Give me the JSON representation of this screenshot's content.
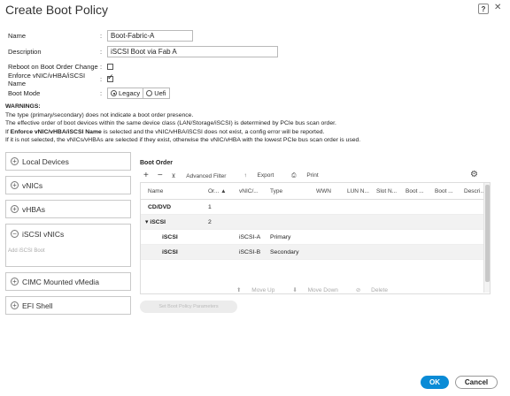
{
  "window": {
    "title": "Create Boot Policy",
    "help_label": "?",
    "close_label": "✕"
  },
  "form": {
    "name_label": "Name",
    "name_value": "Boot-Fabric-A",
    "description_label": "Description",
    "description_value": "iSCSI Boot via Fab A",
    "reboot_label": "Reboot on Boot Order Change",
    "reboot_checked": false,
    "enforce_label": "Enforce vNIC/vHBA/iSCSI Name",
    "enforce_checked": true,
    "bootmode_label": "Boot Mode",
    "bootmode_options": [
      "Legacy",
      "Uefi"
    ],
    "bootmode_selected": "Legacy",
    "colon": ":"
  },
  "warnings": {
    "heading": "WARNINGS:",
    "line1": "The type (primary/secondary) does not indicate a boot order presence.",
    "line2": "The effective order of boot devices within the same device class (LAN/Storage/iSCSI) is determined by PCIe bus scan order.",
    "line3_pre": "If ",
    "line3_bold": "Enforce vNIC/vHBA/iSCSI Name",
    "line3_post": " is selected and the vNIC/vHBA/iSCSI does not exist, a config error will be reported.",
    "line4": "If it is not selected, the vNICs/vHBAs are selected if they exist, otherwise the vNIC/vHBA with the lowest PCIe bus scan order is used."
  },
  "left_panel": {
    "local_devices": "Local Devices",
    "vnics": "vNICs",
    "vhbas": "vHBAs",
    "iscsi_vnics": "iSCSI vNICs",
    "add_iscsi_boot": "Add iSCSI Boot",
    "cimc": "CIMC Mounted vMedia",
    "efi": "EFI Shell",
    "plus": "+",
    "minus": "−"
  },
  "boot_order": {
    "header": "Boot Order",
    "toolbar": {
      "add": "+",
      "remove": "−",
      "filter": "Advanced Filter",
      "export": "Export",
      "print": "Print"
    },
    "columns": [
      "Name",
      "Or...",
      "vNIC/...",
      "Type",
      "WWN",
      "LUN N...",
      "Slot N...",
      "Boot ...",
      "Boot ...",
      "Descri..."
    ],
    "rows": [
      {
        "name": "CD/DVD",
        "order": "1",
        "vnic": "",
        "type": ""
      },
      {
        "name": "iSCSI",
        "order": "2",
        "vnic": "",
        "type": ""
      },
      {
        "name": "iSCSI",
        "order": "",
        "vnic": "iSCSI-A",
        "type": "Primary"
      },
      {
        "name": "iSCSI",
        "order": "",
        "vnic": "iSCSI-B",
        "type": "Secondary"
      }
    ],
    "footer": {
      "move_up": "Move Up",
      "move_down": "Move Down",
      "delete": "Delete"
    },
    "ghost_button": "Set Boot Policy Parameters"
  },
  "actions": {
    "ok": "OK",
    "cancel": "Cancel"
  }
}
